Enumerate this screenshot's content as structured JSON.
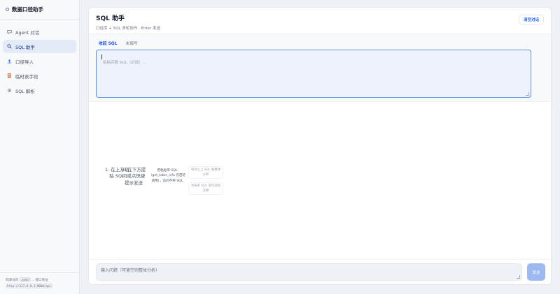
{
  "app": {
    "title": "数据口径助手"
  },
  "sidebar": {
    "items": [
      {
        "label": "Agent 对话",
        "icon": "chat-icon",
        "active": false
      },
      {
        "label": "SQL 助手",
        "icon": "search-icon",
        "active": true
      },
      {
        "label": "口径导入",
        "icon": "import-icon",
        "active": false
      },
      {
        "label": "临时表字段",
        "icon": "table-icon",
        "active": false
      },
      {
        "label": "SQL 解析",
        "icon": "parse-icon",
        "active": false
      }
    ],
    "footer": {
      "prefix": "同源访问",
      "path_code": "/web/",
      "middle": "，接口地址",
      "api_code": "http://127.0.0.1:8000/api"
    }
  },
  "header": {
    "title": "SQL 助手",
    "subtitle": "口径库 + SQL 多轮协作 · Enter 发送",
    "clear_button": "清空对话"
  },
  "sql_panel": {
    "tabs": [
      {
        "label": "收起 SQL",
        "active": true
      },
      {
        "label": "未填写",
        "active": false
      }
    ],
    "placeholder": "粘贴完整 SQL（必填）..."
  },
  "hints": {
    "step1": "1. 在上方粘贴 SQL",
    "step2": "2. 在下方提问或点快捷提示发送",
    "note": "若粘贴带 SQL（get_table_info 仅首轮调用），追问不带 SQL",
    "quick1": "请对以上 SQL 做整体分析",
    "quick2": "为每条 SQL 语句添加注释"
  },
  "composer": {
    "placeholder": "输入问题（可留空则整体分析）",
    "send_label": "发送"
  },
  "colors": {
    "accent": "#2563eb",
    "active_bg": "#e3eaf8",
    "sql_border": "#5b8fe0",
    "send_bg": "#9db9f0"
  }
}
